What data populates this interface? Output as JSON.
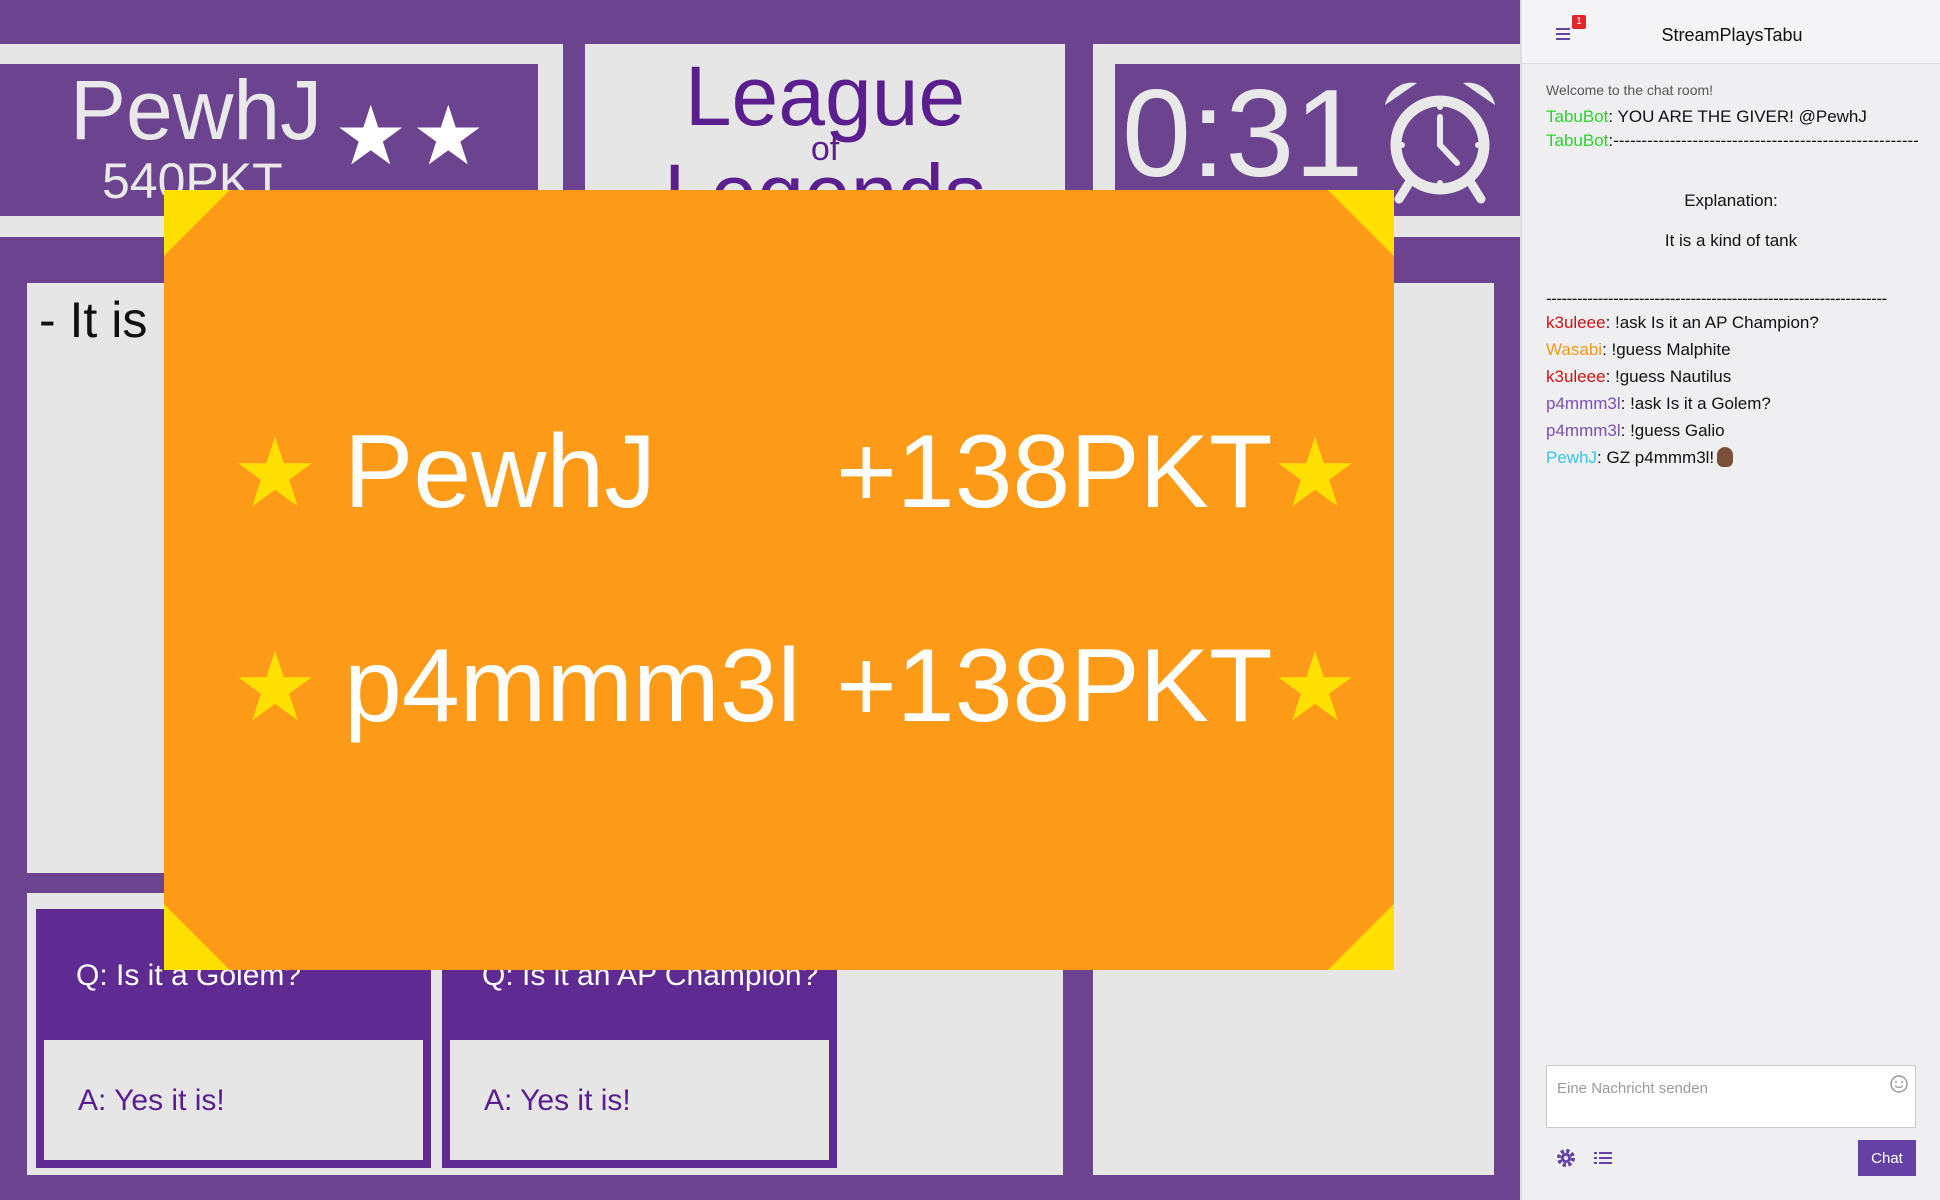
{
  "player": {
    "name": "PewhJ",
    "points": "540PKT",
    "stars": "★★"
  },
  "topic": {
    "line1": "League",
    "line2": "of",
    "line3": "Legends"
  },
  "timer": {
    "value": "0:31",
    "icon": "alarm-clock-icon"
  },
  "explanation": {
    "line": "- It is"
  },
  "qa": [
    {
      "question": "Q: Is it a Golem?",
      "answer": "A: Yes it is!"
    },
    {
      "question": "Q: Is it an AP Champion?",
      "answer": "A: Yes it is!"
    }
  ],
  "overlay": {
    "star": "★",
    "rows": [
      {
        "name": "PewhJ",
        "points": "+138PKT"
      },
      {
        "name": "p4mmm3l",
        "points": "+138PKT"
      }
    ]
  },
  "chat": {
    "title": "StreamPlaysTabu",
    "badge": "1",
    "welcome": "Welcome to the chat room!",
    "messages": [
      {
        "user": "TabuBot",
        "color": "#2ad42a",
        "text": ": YOU ARE THE GIVER! @PewhJ"
      },
      {
        "user": "TabuBot",
        "color": "#2ad42a",
        "text": ":------------------------------------------------------"
      },
      {
        "text": "Explanation:"
      },
      {
        "text": "It is a kind of tank"
      },
      {
        "text": "------------------------------------------------------------------"
      },
      {
        "user": "k3uleee",
        "color": "#cc1414",
        "text": ": !ask Is it an AP Champion?"
      },
      {
        "user": "Wasabi",
        "color": "#f09a1a",
        "text": ": !guess Malphite"
      },
      {
        "user": "k3uleee",
        "color": "#cc1414",
        "text": ": !guess Nautilus"
      },
      {
        "user": "p4mmm3l",
        "color": "#7b4fb3",
        "text": ": !ask Is it a Golem?"
      },
      {
        "user": "p4mmm3l",
        "color": "#7b4fb3",
        "text": ": !guess Galio"
      },
      {
        "user": "PewhJ",
        "color": "#38c5ee",
        "text": ": GZ p4mmm3l!"
      }
    ],
    "input_placeholder": "Eine Nachricht senden",
    "send_label": "Chat"
  }
}
